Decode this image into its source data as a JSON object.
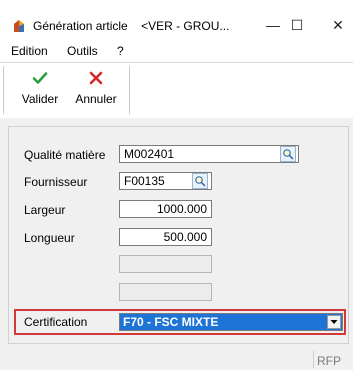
{
  "window": {
    "title": "Génération article",
    "subtitle": "<VER - GROU...",
    "controls": {
      "minimize": "—",
      "maximize": "☐",
      "close": "✕"
    }
  },
  "menu": [
    {
      "label": "Edition"
    },
    {
      "label": "Outils"
    },
    {
      "label": "?"
    }
  ],
  "toolbar": {
    "validate": {
      "label": "Valider",
      "icon": "checkmark-icon",
      "color": "#2e9e3a"
    },
    "cancel": {
      "label": "Annuler",
      "icon": "cross-icon",
      "color": "#d12b2b"
    }
  },
  "form": {
    "qualite": {
      "label": "Qualité matière",
      "value": "M002401"
    },
    "fournisseur": {
      "label": "Fournisseur",
      "value": "F00135"
    },
    "largeur": {
      "label": "Largeur",
      "value": "1000.000"
    },
    "longueur": {
      "label": "Longueur",
      "value": "500.000"
    },
    "certification": {
      "label": "Certification",
      "value": "F70 - FSC MIXTE"
    }
  },
  "status": {
    "code": "RFP"
  },
  "colors": {
    "highlight_frame": "#d23a3a",
    "selected_bg": "#1e73d6"
  }
}
